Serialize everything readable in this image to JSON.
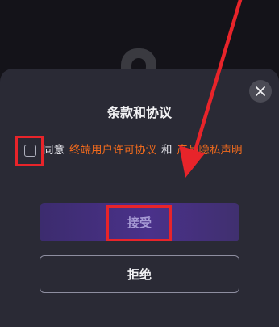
{
  "dialog": {
    "title": "条款和协议",
    "agree_prefix": "同意",
    "terms_link": "终端用户许可协议",
    "conjunction": "和",
    "privacy_link": "隐私声明",
    "privacy_partial": "隐私声明",
    "privacy_hidden": "产品"
  },
  "buttons": {
    "accept_label": "接受",
    "reject_label": "拒绝"
  },
  "colors": {
    "sheet_bg": "#2a2a35",
    "link": "#f06a1d",
    "accept_bg": "#4a318a",
    "annotation_red": "#e8242a"
  },
  "icons": {
    "close": "close-icon",
    "pin": "pin-icon"
  }
}
